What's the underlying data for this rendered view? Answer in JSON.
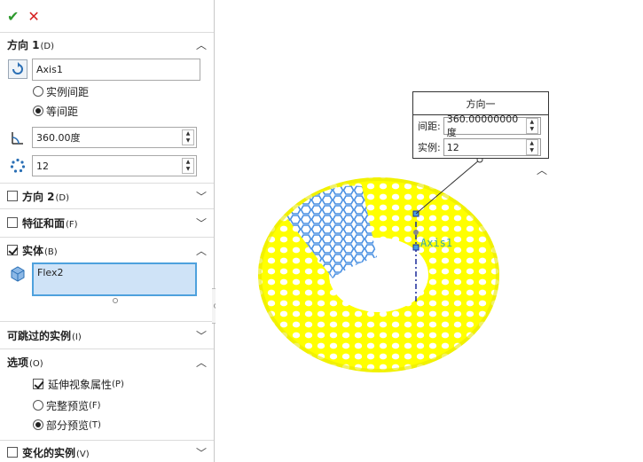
{
  "toolbar": {
    "ok_glyph": "✔",
    "cancel_glyph": "✕"
  },
  "direction1": {
    "title": "方向 1",
    "suffix": "(D)",
    "axis_value": "Axis1",
    "options": [
      {
        "label": "实例间距",
        "selected": false
      },
      {
        "label": "等间距",
        "selected": true
      }
    ],
    "angle_value": "360.00度",
    "count_value": "12"
  },
  "direction2": {
    "title": "方向 2",
    "suffix": "(D)",
    "checked": false
  },
  "features": {
    "title": "特征和面",
    "suffix": "(F)",
    "checked": false
  },
  "bodies": {
    "title": "实体",
    "suffix": "(B)",
    "checked": true,
    "list": [
      "Flex2"
    ]
  },
  "skip": {
    "title": "可跳过的实例",
    "suffix": "(I)"
  },
  "options": {
    "title": "选项",
    "suffix": "(O)",
    "propagate": {
      "label": "延伸视象属性",
      "suffix": "(P)",
      "checked": true
    },
    "full_preview": {
      "label": "完整预览",
      "suffix": "(F)",
      "selected": false
    },
    "partial_preview": {
      "label": "部分预览",
      "suffix": "(T)",
      "selected": true
    }
  },
  "varied": {
    "title": "变化的实例",
    "suffix": "(V)",
    "checked": false
  },
  "callout": {
    "title": "方向一",
    "spacing_label": "间距:",
    "spacing_value": "360.00000000度",
    "count_label": "实例:",
    "count_value": "12"
  },
  "axis_label": "Axis1",
  "colors": {
    "torus": "#ffff00",
    "body": "#4a90e2",
    "ok": "#2e9a2e",
    "cancel": "#d62020",
    "selection": "#cfe3f7"
  }
}
